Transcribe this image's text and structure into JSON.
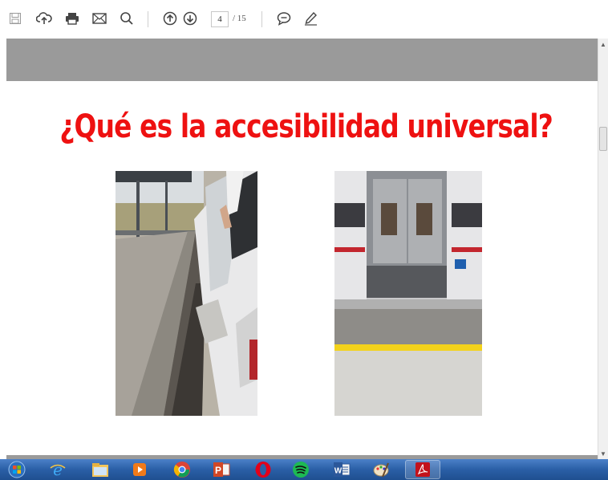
{
  "toolbar": {
    "buttons": [
      "save-icon",
      "upload-icon",
      "print-icon",
      "email-icon",
      "search-icon",
      "arrow-up-icon",
      "arrow-down-icon",
      "comment-icon",
      "pen-icon"
    ],
    "current_page": "4",
    "page_total": "/ 15"
  },
  "slide": {
    "title": "¿Qué es la accesibilidad universal?",
    "title_color": "#ee1111"
  },
  "taskbar": {
    "items": [
      "start-orb-icon",
      "internet-explorer-icon",
      "file-explorer-icon",
      "media-player-icon",
      "chrome-icon",
      "powerpoint-icon",
      "opera-icon",
      "spotify-icon",
      "word-icon",
      "paint-icon",
      "acrobat-icon"
    ]
  }
}
